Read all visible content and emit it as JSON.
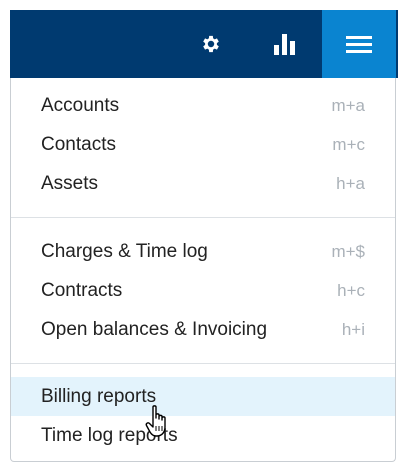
{
  "toolbar": {
    "icons": [
      "gear-icon",
      "bar-chart-icon",
      "hamburger-menu-icon"
    ],
    "colors": {
      "bar": "#003a70",
      "active_button": "#0a84d0"
    }
  },
  "menu": {
    "groups": [
      [
        {
          "label": "Accounts",
          "shortcut": "m+a"
        },
        {
          "label": "Contacts",
          "shortcut": "m+c"
        },
        {
          "label": "Assets",
          "shortcut": "h+a"
        }
      ],
      [
        {
          "label": "Charges & Time log",
          "shortcut": "m+$"
        },
        {
          "label": "Contracts",
          "shortcut": "h+c"
        },
        {
          "label": "Open balances & Invoicing",
          "shortcut": "h+i"
        }
      ],
      [
        {
          "label": "Billing reports",
          "shortcut": ""
        },
        {
          "label": "Time log reports",
          "shortcut": ""
        }
      ]
    ],
    "highlighted_item": "Billing reports"
  }
}
